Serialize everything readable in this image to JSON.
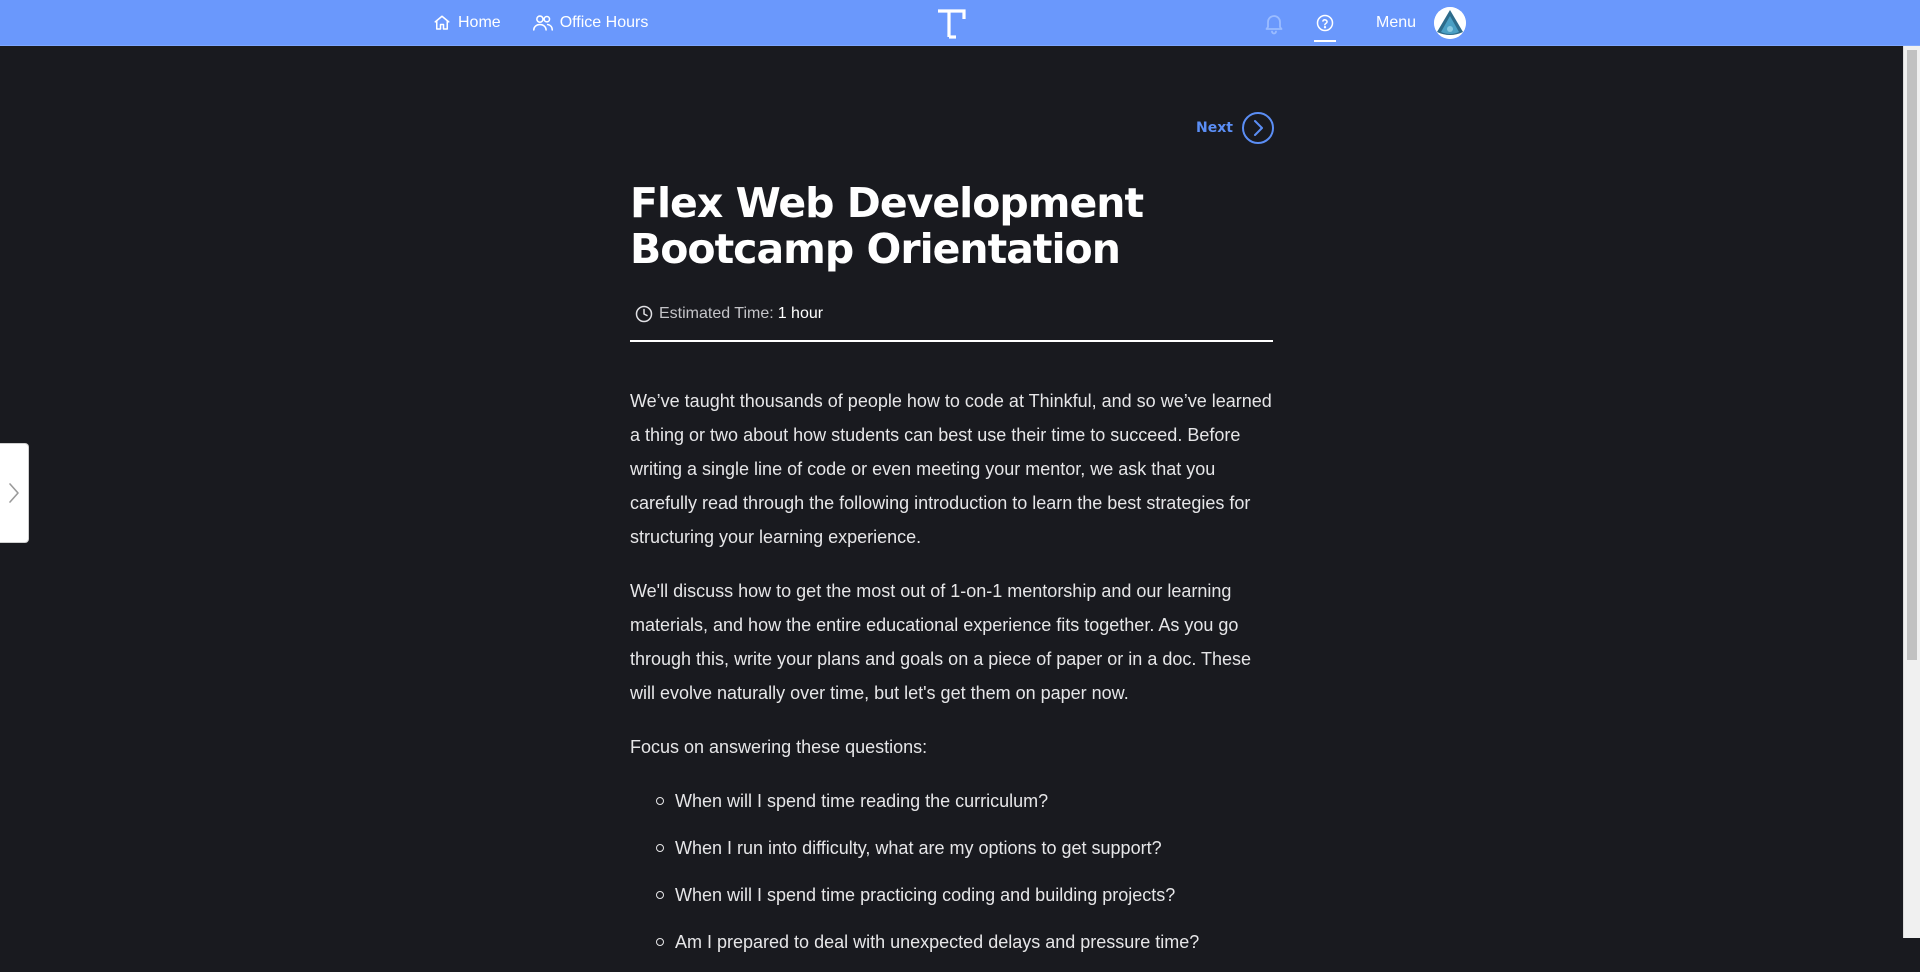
{
  "nav": {
    "home_label": "Home",
    "office_hours_label": "Office Hours",
    "menu_label": "Menu",
    "icons": {
      "home": "home-icon",
      "office_hours": "users-icon",
      "logo": "thinkful-logo",
      "bell": "bell-icon",
      "help": "help-circle-icon",
      "avatar": "user-avatar"
    }
  },
  "pager": {
    "next_label": "Next"
  },
  "lesson": {
    "title": "Flex Web Development Bootcamp Orientation",
    "estimated_time_label": "Estimated Time:",
    "estimated_time_value": "1 hour",
    "paragraphs": [
      "We’ve taught thousands of people how to code at Thinkful, and so we’ve learned a thing or two about how students can best use their time to succeed. Before writing a single line of code or even meeting your mentor, we ask that you carefully read through the following introduction to learn the best strategies for structuring your learning experience.",
      "We'll discuss how to get the most out of 1-on-1 mentorship and our learning materials, and how the entire educational experience fits together. As you go through this, write your plans and goals on a piece of paper or in a doc. These will evolve naturally over time, but let's get them on paper now.",
      "Focus on answering these questions:"
    ],
    "questions": [
      "When will I spend time reading the curriculum?",
      "When I run into difficulty, what are my options to get support?",
      "When will I spend time practicing coding and building projects?",
      "Am I prepared to deal with unexpected delays and pressure time?"
    ]
  },
  "colors": {
    "topbar": "#6a98fc",
    "background": "#191a1f",
    "accent": "#5b8ef5",
    "text": "#e6e6e8"
  }
}
